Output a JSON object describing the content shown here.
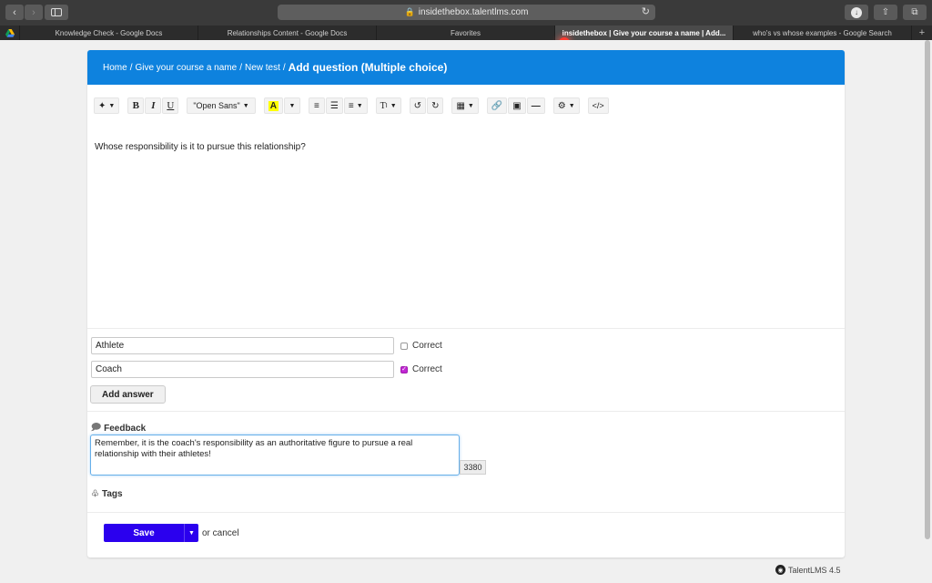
{
  "browser": {
    "url": "insidethebox.talentlms.com",
    "tabs": [
      {
        "label": "Knowledge Check - Google Docs",
        "active": false
      },
      {
        "label": "Relationships Content - Google Docs",
        "active": false
      },
      {
        "label": "Favorites",
        "active": false
      },
      {
        "label": "insidethebox | Give your course a name | Add...",
        "active": true
      },
      {
        "label": "who's vs whose examples - Google Search",
        "active": false
      }
    ]
  },
  "breadcrumb": {
    "home": "Home",
    "course": "Give your course a name",
    "test": "New test",
    "current": "Add question (Multiple choice)",
    "separator": "/"
  },
  "toolbar": {
    "font_name": "\"Open Sans\"",
    "bold": "B",
    "italic": "I",
    "underline": "U",
    "highlight": "A",
    "text_size": "T",
    "code": "</>"
  },
  "question": {
    "text": "Whose responsibility is it to pursue this relationship?"
  },
  "answers": [
    {
      "value": "Athlete",
      "correct": false,
      "correct_label": "Correct"
    },
    {
      "value": "Coach",
      "correct": true,
      "correct_label": "Correct"
    }
  ],
  "add_answer_label": "Add answer",
  "feedback": {
    "label": "Feedback",
    "text": "Remember, it is the coach's responsibility as an authoritative figure to pursue a real relationship with their athletes!",
    "char_count": "3380"
  },
  "tags": {
    "label": "Tags"
  },
  "actions": {
    "save_label": "Save",
    "or_cancel": "or cancel"
  },
  "footer": {
    "brand": "TalentLMS 4.5"
  },
  "colors": {
    "header_blue": "#0e82de",
    "save_button": "#2b00ee",
    "checkbox_checked": "#c026d3"
  }
}
